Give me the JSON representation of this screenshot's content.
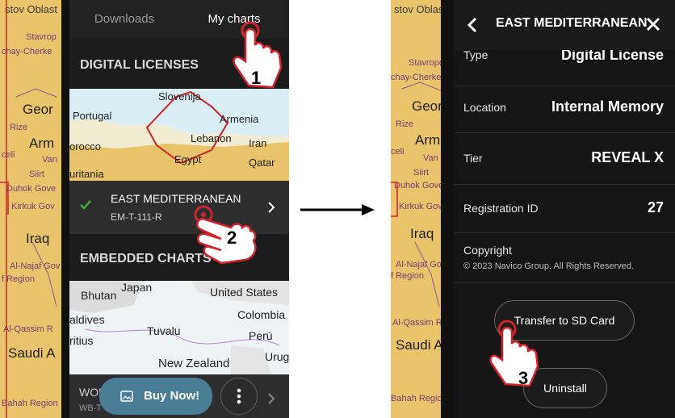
{
  "left": {
    "map_labels": [
      "stov Oblast",
      "Stavrop",
      "chay-Cherke",
      "Geor",
      "Rize",
      "Arm",
      "celi",
      "Van",
      "Siirt",
      "Duhok Gove",
      "Kirkuk Gov",
      "Iraq",
      "Al-Najaf Gov",
      "f Region",
      "Al-Qassim R",
      "Saudi A",
      "Bahah Region"
    ],
    "tabs": [
      {
        "label": "Downloads",
        "active": false
      },
      {
        "label": "My charts",
        "active": true
      }
    ],
    "digital_licenses_heading": "DIGITAL LICENSES",
    "chart_preview_labels": [
      "Slovenija",
      "Portugal",
      "Armenia",
      "Lebanon",
      "Iran",
      "orocco",
      "Egypt",
      "Qatar",
      "uritania"
    ],
    "license_item": {
      "name": "EAST MEDITERRANEAN",
      "code": "EM-T-111-R",
      "status_icon": "checkmark-icon"
    },
    "embedded_heading": "EMBEDDED CHARTS",
    "embedded_preview_labels": [
      "Japan",
      "United States",
      "Bhutan",
      "Colombia",
      "aldives",
      "Tuvalu",
      "ritius",
      "Perú",
      "New Zealand",
      "Urug"
    ],
    "embedded_item": {
      "name": "WOR",
      "code": "WB-T"
    },
    "buy_now_label": "Buy Now!",
    "more_icon": "more-vertical-icon"
  },
  "right": {
    "map_labels": [
      "stov Oblast",
      "Stavropo",
      "chay-Cherke",
      "Geor",
      "Rize",
      "Arm",
      "celi",
      "Van",
      "Siirt",
      "Duhok Gove",
      "Kirkuk Gov",
      "Iraq",
      "Al-Najaf Gov",
      "f Region",
      "Al-Qassim R",
      "Saudi A",
      "Bahah Region"
    ],
    "title": "EAST MEDITERRANEAN",
    "rows": [
      {
        "label": "Type",
        "value": "Digital License"
      },
      {
        "label": "Location",
        "value": "Internal Memory"
      },
      {
        "label": "Tier",
        "value": "REVEAL X"
      },
      {
        "label": "Registration ID",
        "value": "27"
      }
    ],
    "copyright_label": "Copyright",
    "copyright_text": "© 2023 Navico Group. All Rights Reserved.",
    "transfer_label": "Transfer to SD Card",
    "uninstall_label": "Uninstall"
  },
  "steps": [
    "1",
    "2",
    "3"
  ],
  "colors": {
    "map": "#e9c46a",
    "accent_green": "#3fae3f",
    "button_blue": "#4a7d96",
    "step_red": "#d0242c"
  }
}
